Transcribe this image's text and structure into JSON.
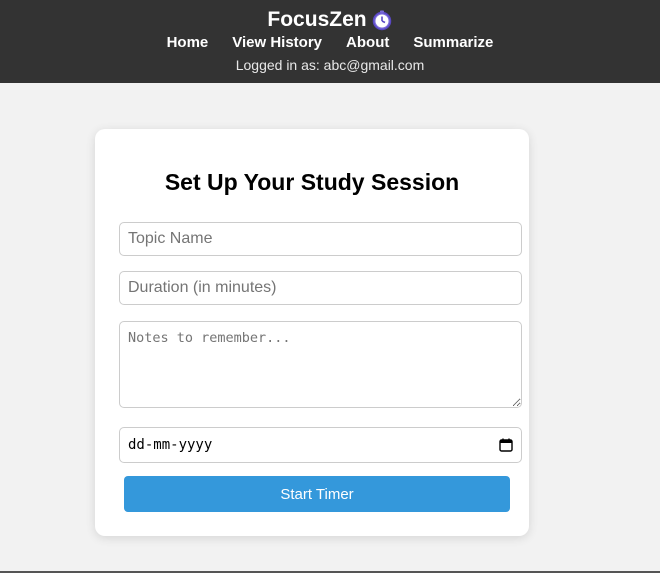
{
  "header": {
    "brand": "FocusZen",
    "brand_icon": "alarm-clock-icon",
    "nav": [
      "Home",
      "View History",
      "About",
      "Summarize"
    ],
    "logged_in_text": "Logged in as: abc@gmail.com"
  },
  "form": {
    "title": "Set Up Your Study Session",
    "topic_placeholder": "Topic Name",
    "duration_placeholder": "Duration (in minutes)",
    "notes_placeholder": "Notes to remember...",
    "date_value": "dd-mm-yyyy",
    "date_icon": "calendar-icon",
    "submit_label": "Start Timer"
  },
  "colors": {
    "header_bg": "#333333",
    "page_bg": "#f2f2f2",
    "button_bg": "#3498db"
  }
}
